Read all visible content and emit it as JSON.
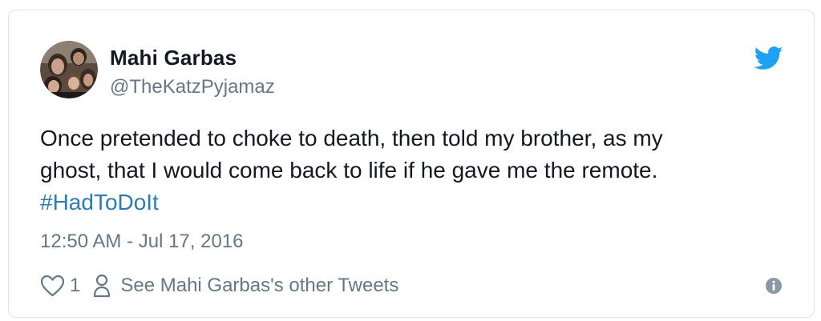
{
  "user": {
    "display_name": "Mahi Garbas",
    "handle": "@TheKatzPyjamaz",
    "avatar_icon": "profile-photo"
  },
  "tweet": {
    "text_line1": "Once pretended to choke to death, then told my brother, as my",
    "text_line2": "ghost, that I would come back to life if he gave me the remote.",
    "hashtag": "#HadToDoIt",
    "timestamp": "12:50 AM - Jul 17, 2016"
  },
  "actions": {
    "like_count": "1",
    "other_tweets_label": "See Mahi Garbas's other Tweets"
  },
  "icons": {
    "brand": "twitter-bird-icon",
    "like": "heart-icon",
    "profile": "person-icon",
    "info": "info-icon"
  },
  "colors": {
    "twitter_blue": "#1da1f2",
    "hashtag_blue": "#2b7bb9",
    "text_dark": "#141823",
    "text_gray": "#657786"
  }
}
